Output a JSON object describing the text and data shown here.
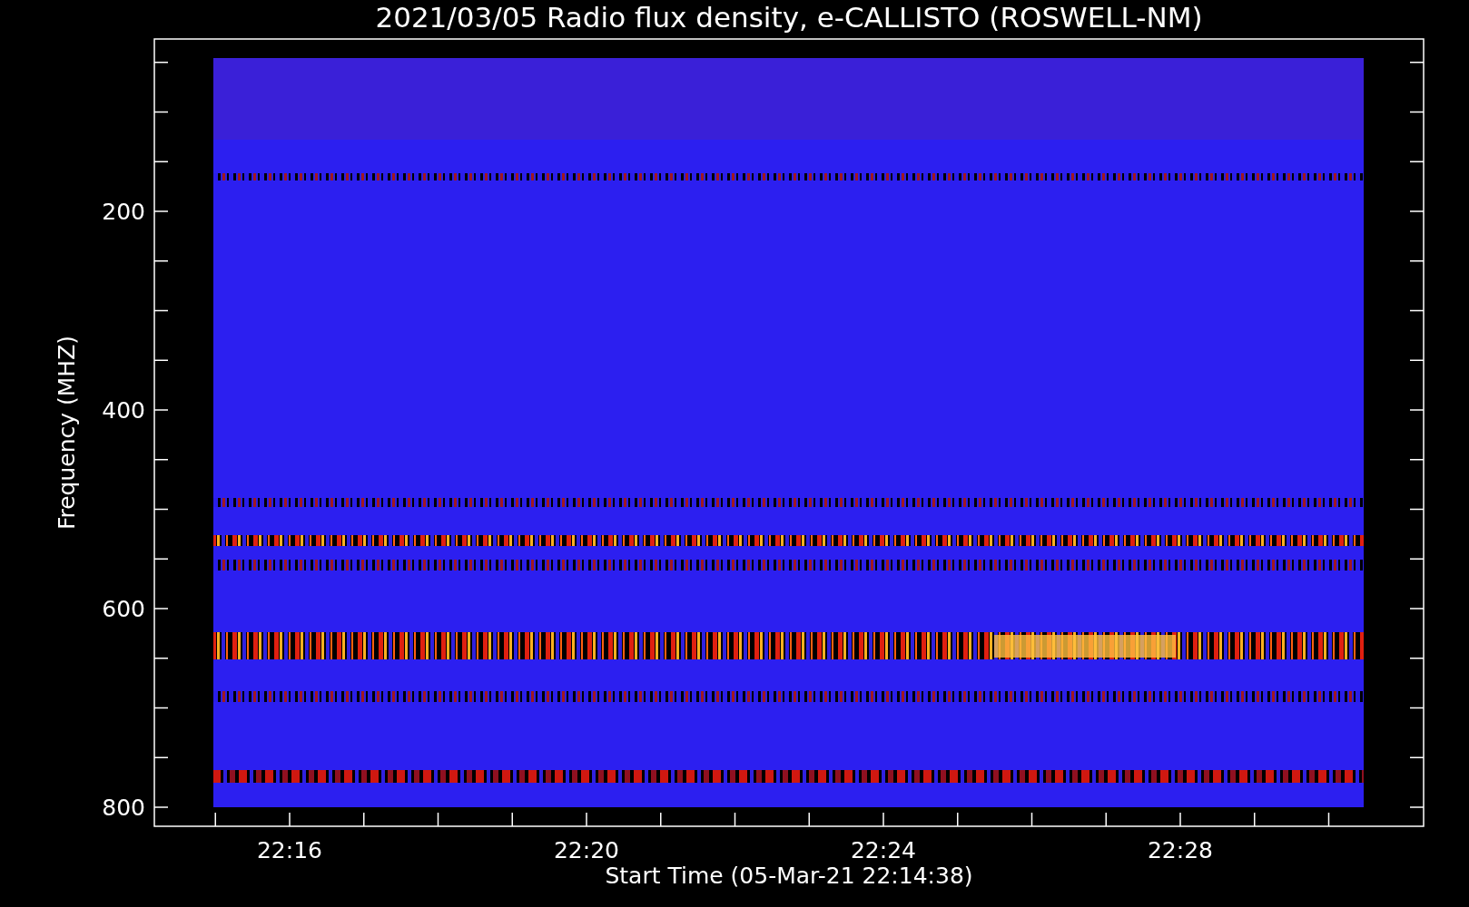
{
  "title": "2021/03/05  Radio flux density, e-CALLISTO (ROSWELL-NM)",
  "y_axis": {
    "label": "Frequency (MHZ)",
    "ticks": [
      "200",
      "400",
      "600",
      "800"
    ]
  },
  "x_axis": {
    "label": "Start Time (05-Mar-21 22:14:38)",
    "ticks": [
      "22:16",
      "22:20",
      "22:24",
      "22:28"
    ]
  }
}
